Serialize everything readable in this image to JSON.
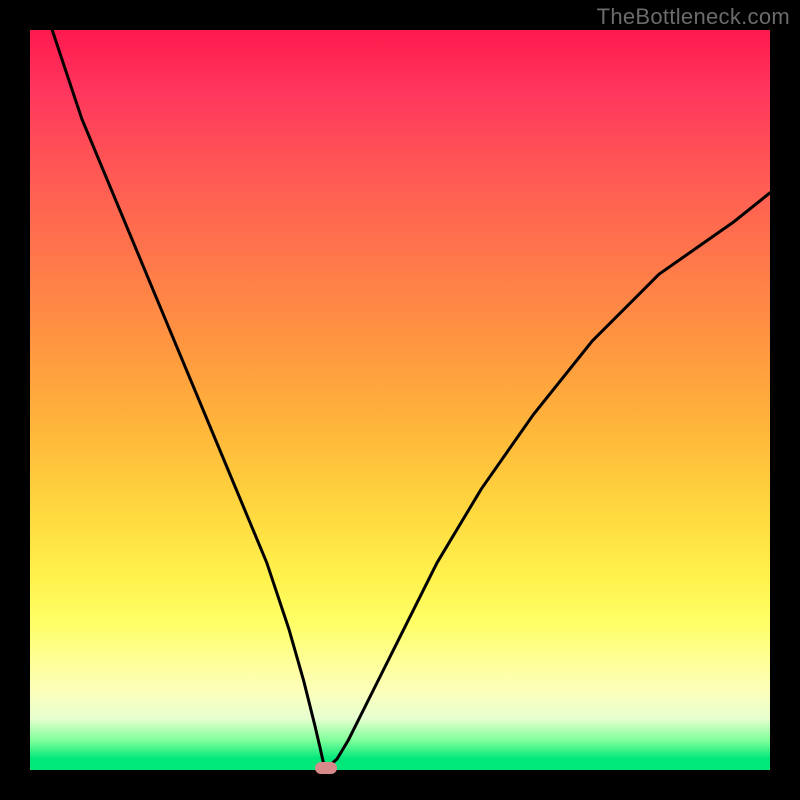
{
  "watermark": "TheBottleneck.com",
  "chart_data": {
    "type": "line",
    "title": "",
    "xlabel": "",
    "ylabel": "",
    "xlim": [
      0,
      100
    ],
    "ylim": [
      0,
      100
    ],
    "grid": false,
    "legend": false,
    "series": [
      {
        "name": "curve",
        "x": [
          3,
          7,
          12,
          17,
          22,
          27,
          32,
          35,
          37,
          38.5,
          39.2,
          39.6,
          39.9,
          40.5,
          41.5,
          43,
          46,
          50,
          55,
          61,
          68,
          76,
          85,
          95,
          100
        ],
        "y": [
          100,
          88,
          76,
          64,
          52,
          40,
          28,
          19,
          12,
          6,
          3,
          1.2,
          0.4,
          0.6,
          1.5,
          4,
          10,
          18,
          28,
          38,
          48,
          58,
          67,
          74,
          78
        ]
      }
    ],
    "minimum_marker": {
      "x": 40,
      "y": 0
    },
    "gradient_stops": [
      {
        "pos": 0.0,
        "color": "#ff1a4d"
      },
      {
        "pos": 0.18,
        "color": "#ff5555"
      },
      {
        "pos": 0.44,
        "color": "#ff9a3f"
      },
      {
        "pos": 0.65,
        "color": "#ffd83f"
      },
      {
        "pos": 0.8,
        "color": "#ffff66"
      },
      {
        "pos": 0.93,
        "color": "#e8ffd0"
      },
      {
        "pos": 1.0,
        "color": "#00e87a"
      }
    ]
  }
}
